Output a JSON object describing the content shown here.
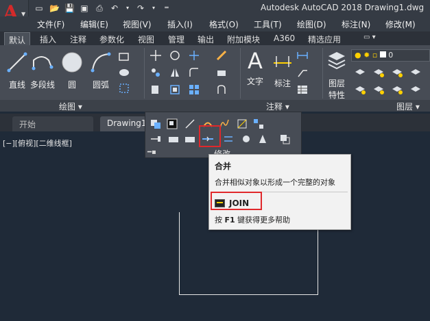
{
  "window": {
    "title": "Autodesk AutoCAD 2018   Drawing1.dwg"
  },
  "menu": [
    "文件(F)",
    "编辑(E)",
    "视图(V)",
    "插入(I)",
    "格式(O)",
    "工具(T)",
    "绘图(D)",
    "标注(N)",
    "修改(M)"
  ],
  "ribbon_tabs": [
    "默认",
    "插入",
    "注释",
    "参数化",
    "视图",
    "管理",
    "输出",
    "附加模块",
    "A360",
    "精选应用"
  ],
  "draw_panel": {
    "line": "直线",
    "polyline": "多段线",
    "circle": "圆",
    "arc": "圆弧",
    "title": "绘图"
  },
  "annotation_panel": {
    "text": "文字",
    "dimension": "标注",
    "title": "注释"
  },
  "layers_panel": {
    "props_line1": "图层",
    "props_line2": "特性",
    "title": "图层",
    "layer_value": "0"
  },
  "modify_panel": {
    "title": "修改"
  },
  "doc_tabs": [
    "开始",
    "Drawing1"
  ],
  "viewport": {
    "label": "[−][俯视][二维线框]"
  },
  "tooltip": {
    "title": "合并",
    "description": "合并相似对象以形成一个完整的对象",
    "command": "JOIN",
    "help_prefix": "按",
    "help_key": "F1",
    "help_suffix": "键获得更多帮助"
  },
  "colors": {
    "highlight": "#e0282b",
    "logo": "#d42a2a",
    "ribbon": "#474c55",
    "viewport": "#1f2a38"
  }
}
